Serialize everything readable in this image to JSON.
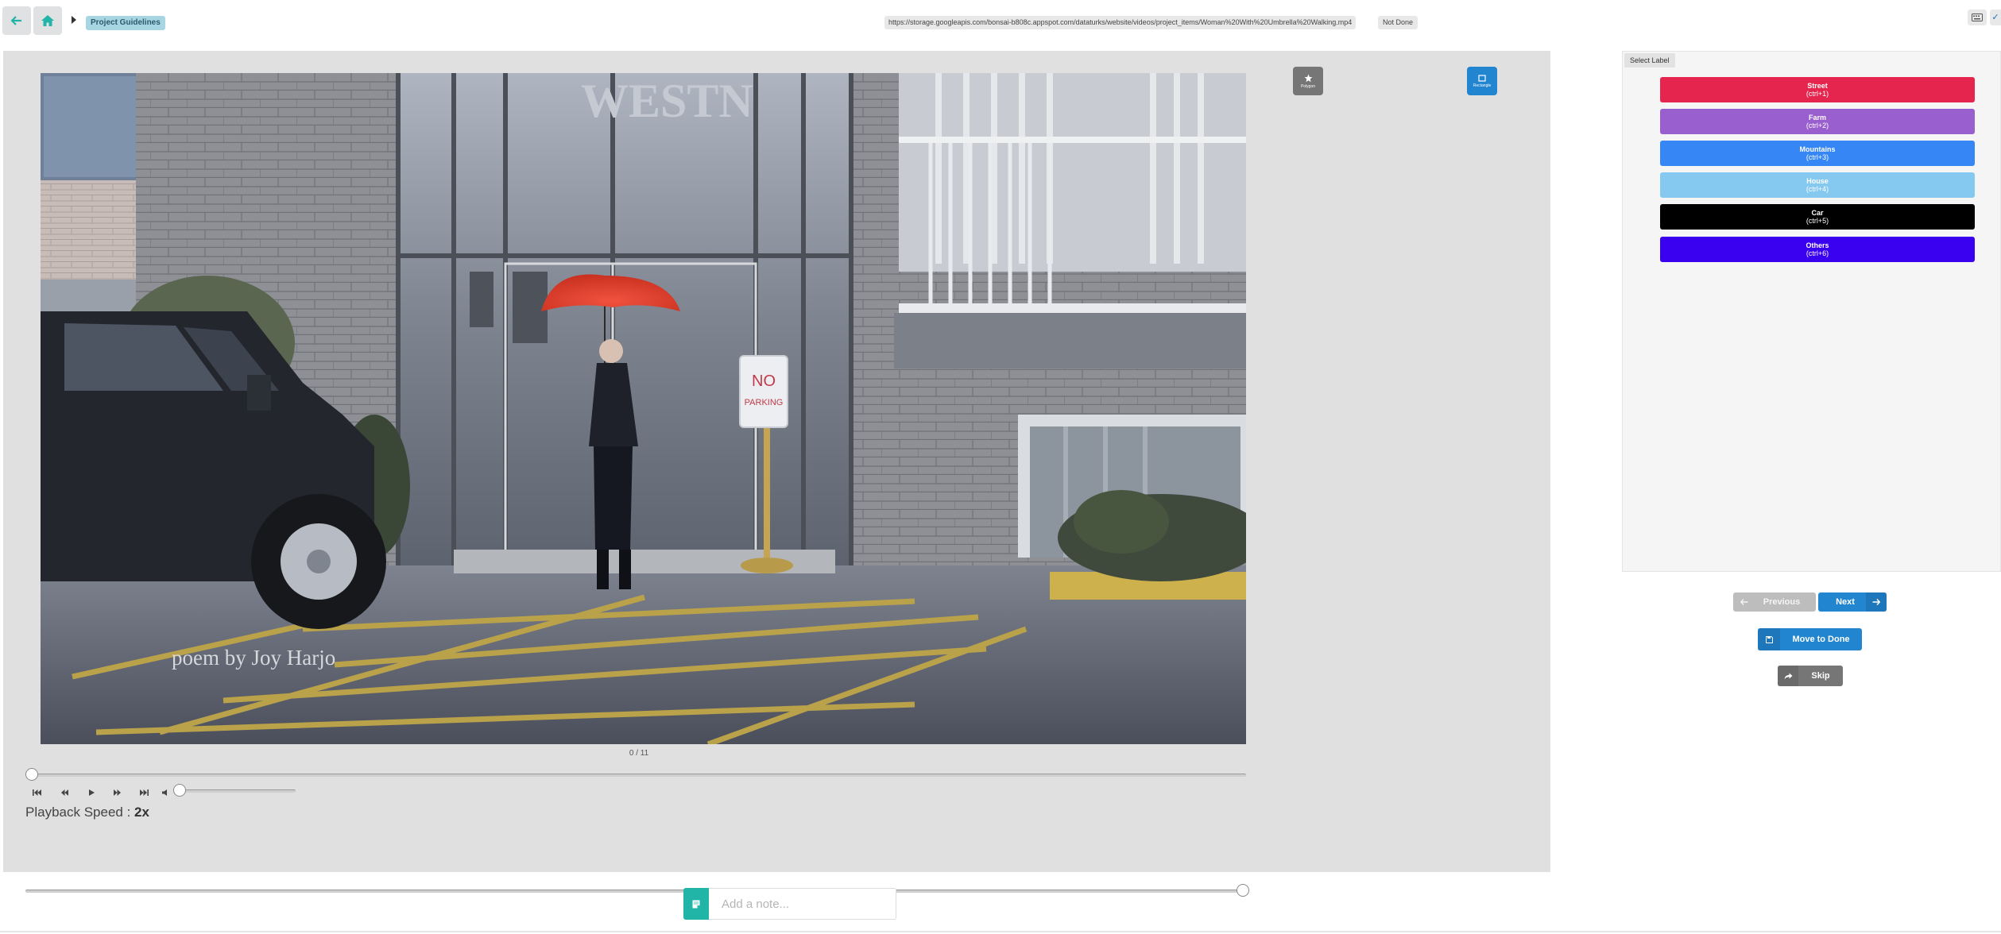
{
  "topbar": {
    "guidelines_label": "Project Guidelines",
    "video_url": "https://storage.googleapis.com/bonsai-b808c.appspot.com/dataturks/website/videos/project_items/Woman%20With%20Umbrella%20Walking.mp4",
    "status": "Not Done",
    "check_icon": "✓"
  },
  "tools": {
    "polygon_label": "Polygon",
    "rectangle_label": "Rectangle"
  },
  "video": {
    "overlay_caption": "poem by Joy Harjo",
    "sign_line1": "NO",
    "sign_line2": "PARKING",
    "building_text": "WESTN",
    "frame_counter": "0 / 11",
    "playback_speed_label": "Playback Speed : ",
    "playback_speed_value": "2x",
    "seek_position": 0,
    "volume_level": 0,
    "speed_slider_position": 1.0
  },
  "labels": {
    "select_label": "Select Label",
    "items": [
      {
        "name": "Street",
        "shortcut": "(ctrl+1)",
        "color": "#e5254d",
        "text_color": "#ffffff"
      },
      {
        "name": "Farm",
        "shortcut": "(ctrl+2)",
        "color": "#9a5fcf",
        "text_color": "#ffffff"
      },
      {
        "name": "Mountains",
        "shortcut": "(ctrl+3)",
        "color": "#3686f6",
        "text_color": "#ffffff"
      },
      {
        "name": "House",
        "shortcut": "(ctrl+4)",
        "color": "#86c9f0",
        "text_color": "#ffffff"
      },
      {
        "name": "Car",
        "shortcut": "(ctrl+5)",
        "color": "#000000",
        "text_color": "#ffffff"
      },
      {
        "name": "Others",
        "shortcut": "(ctrl+6)",
        "color": "#3a00f0",
        "text_color": "#ffffff"
      }
    ]
  },
  "nav": {
    "previous_label": "Previous",
    "next_label": "Next",
    "done_label": "Move to Done",
    "skip_label": "Skip"
  },
  "note": {
    "placeholder": "Add a note..."
  },
  "colors": {
    "accent": "#2185d0",
    "teal": "#21b5a8",
    "panel_bg": "#e0e0e0"
  }
}
